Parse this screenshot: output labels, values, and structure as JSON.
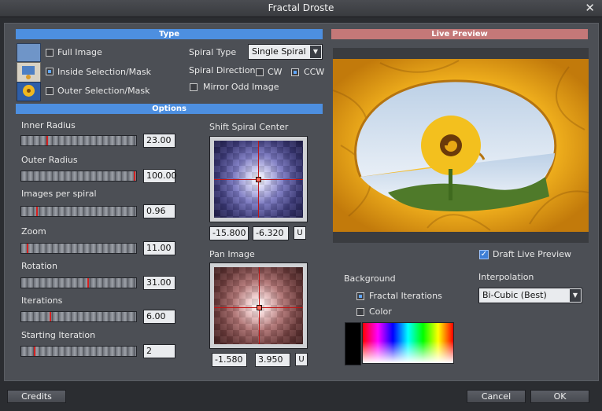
{
  "window": {
    "title": "Fractal Droste",
    "close_glyph": "✕"
  },
  "type_section": {
    "header": "Type",
    "options": [
      {
        "label": "Full Image",
        "selected": false
      },
      {
        "label": "Inside Selection/Mask",
        "selected": true
      },
      {
        "label": "Outer Selection/Mask",
        "selected": false
      }
    ],
    "spiral_type": {
      "label": "Spiral Type",
      "value": "Single Spiral"
    },
    "spiral_direction": {
      "label": "Spiral Direction",
      "cw": "CW",
      "ccw": "CCW",
      "selected": "CCW"
    },
    "mirror_odd": {
      "label": "Mirror Odd Image",
      "checked": false
    }
  },
  "options_section": {
    "header": "Options",
    "sliders": [
      {
        "label": "Inner Radius",
        "value": "23.00",
        "position": 0.22
      },
      {
        "label": "Outer Radius",
        "value": "100.00",
        "position": 0.99
      },
      {
        "label": "Images per spiral",
        "value": "0.96",
        "position": 0.13
      },
      {
        "label": "Zoom",
        "value": "11.00",
        "position": 0.05
      },
      {
        "label": "Rotation",
        "value": "31.00",
        "position": 0.58
      },
      {
        "label": "Iterations",
        "value": "6.00",
        "position": 0.25
      },
      {
        "label": "Starting Iteration",
        "value": "2",
        "position": 0.11
      }
    ],
    "shift_center": {
      "label": "Shift Spiral Center",
      "x": "-15.800",
      "y": "-6.320",
      "u": "U"
    },
    "pan_image": {
      "label": "Pan Image",
      "x": "-1.580",
      "y": "3.950",
      "u": "U"
    }
  },
  "preview": {
    "header": "Live Preview",
    "draft": {
      "label": "Draft Live Preview",
      "checked": true
    }
  },
  "background": {
    "label": "Background",
    "fractal": "Fractal Iterations",
    "color": "Color",
    "selected": "Fractal Iterations",
    "swatch_color": "#000000"
  },
  "interpolation": {
    "label": "Interpolation",
    "value": "Bi-Cubic (Best)"
  },
  "footer": {
    "credits": "Credits",
    "cancel": "Cancel",
    "ok": "OK"
  },
  "colors": {
    "type_header": "#4d8fe0",
    "preview_header": "#c47878",
    "crosshair": "#c01515"
  }
}
